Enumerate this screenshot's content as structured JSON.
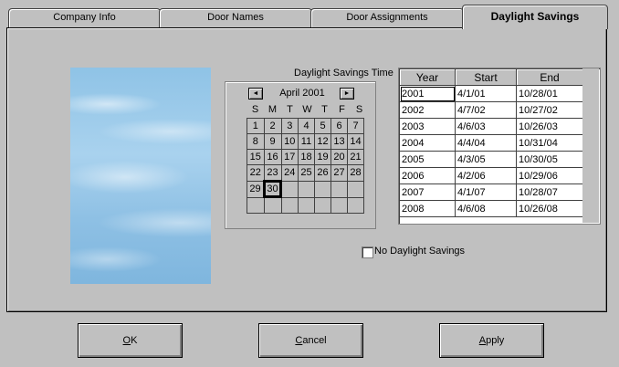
{
  "tabs": [
    {
      "label": "Company Info"
    },
    {
      "label": "Door Names"
    },
    {
      "label": "Door Assignments"
    },
    {
      "label": "Daylight Savings"
    }
  ],
  "calendar": {
    "title": "Daylight Savings Time",
    "month_label": "April 2001",
    "prev_symbol": "◄",
    "next_symbol": "►",
    "weekdays": [
      "S",
      "M",
      "T",
      "W",
      "T",
      "F",
      "S"
    ],
    "weeks": [
      [
        "1",
        "2",
        "3",
        "4",
        "5",
        "6",
        "7"
      ],
      [
        "8",
        "9",
        "10",
        "11",
        "12",
        "13",
        "14"
      ],
      [
        "15",
        "16",
        "17",
        "18",
        "19",
        "20",
        "21"
      ],
      [
        "22",
        "23",
        "24",
        "25",
        "26",
        "27",
        "28"
      ],
      [
        "29",
        "30",
        "",
        "",
        "",
        "",
        ""
      ],
      [
        "",
        "",
        "",
        "",
        "",
        "",
        ""
      ]
    ],
    "selected_day": "30"
  },
  "dst_table": {
    "headers": [
      "Year",
      "Start",
      "End"
    ],
    "rows": [
      [
        "2001",
        "4/1/01",
        "10/28/01"
      ],
      [
        "2002",
        "4/7/02",
        "10/27/02"
      ],
      [
        "2003",
        "4/6/03",
        "10/26/03"
      ],
      [
        "2004",
        "4/4/04",
        "10/31/04"
      ],
      [
        "2005",
        "4/3/05",
        "10/30/05"
      ],
      [
        "2006",
        "4/2/06",
        "10/29/06"
      ],
      [
        "2007",
        "4/1/07",
        "10/28/07"
      ],
      [
        "2008",
        "4/6/08",
        "10/26/08"
      ]
    ]
  },
  "no_dst": {
    "label": "No Daylight Savings",
    "checked": false
  },
  "buttons": {
    "ok": {
      "mnemonic": "O",
      "rest": "K"
    },
    "cancel": {
      "mnemonic": "C",
      "rest": "ancel"
    },
    "apply": {
      "mnemonic": "A",
      "rest": "pply"
    }
  }
}
